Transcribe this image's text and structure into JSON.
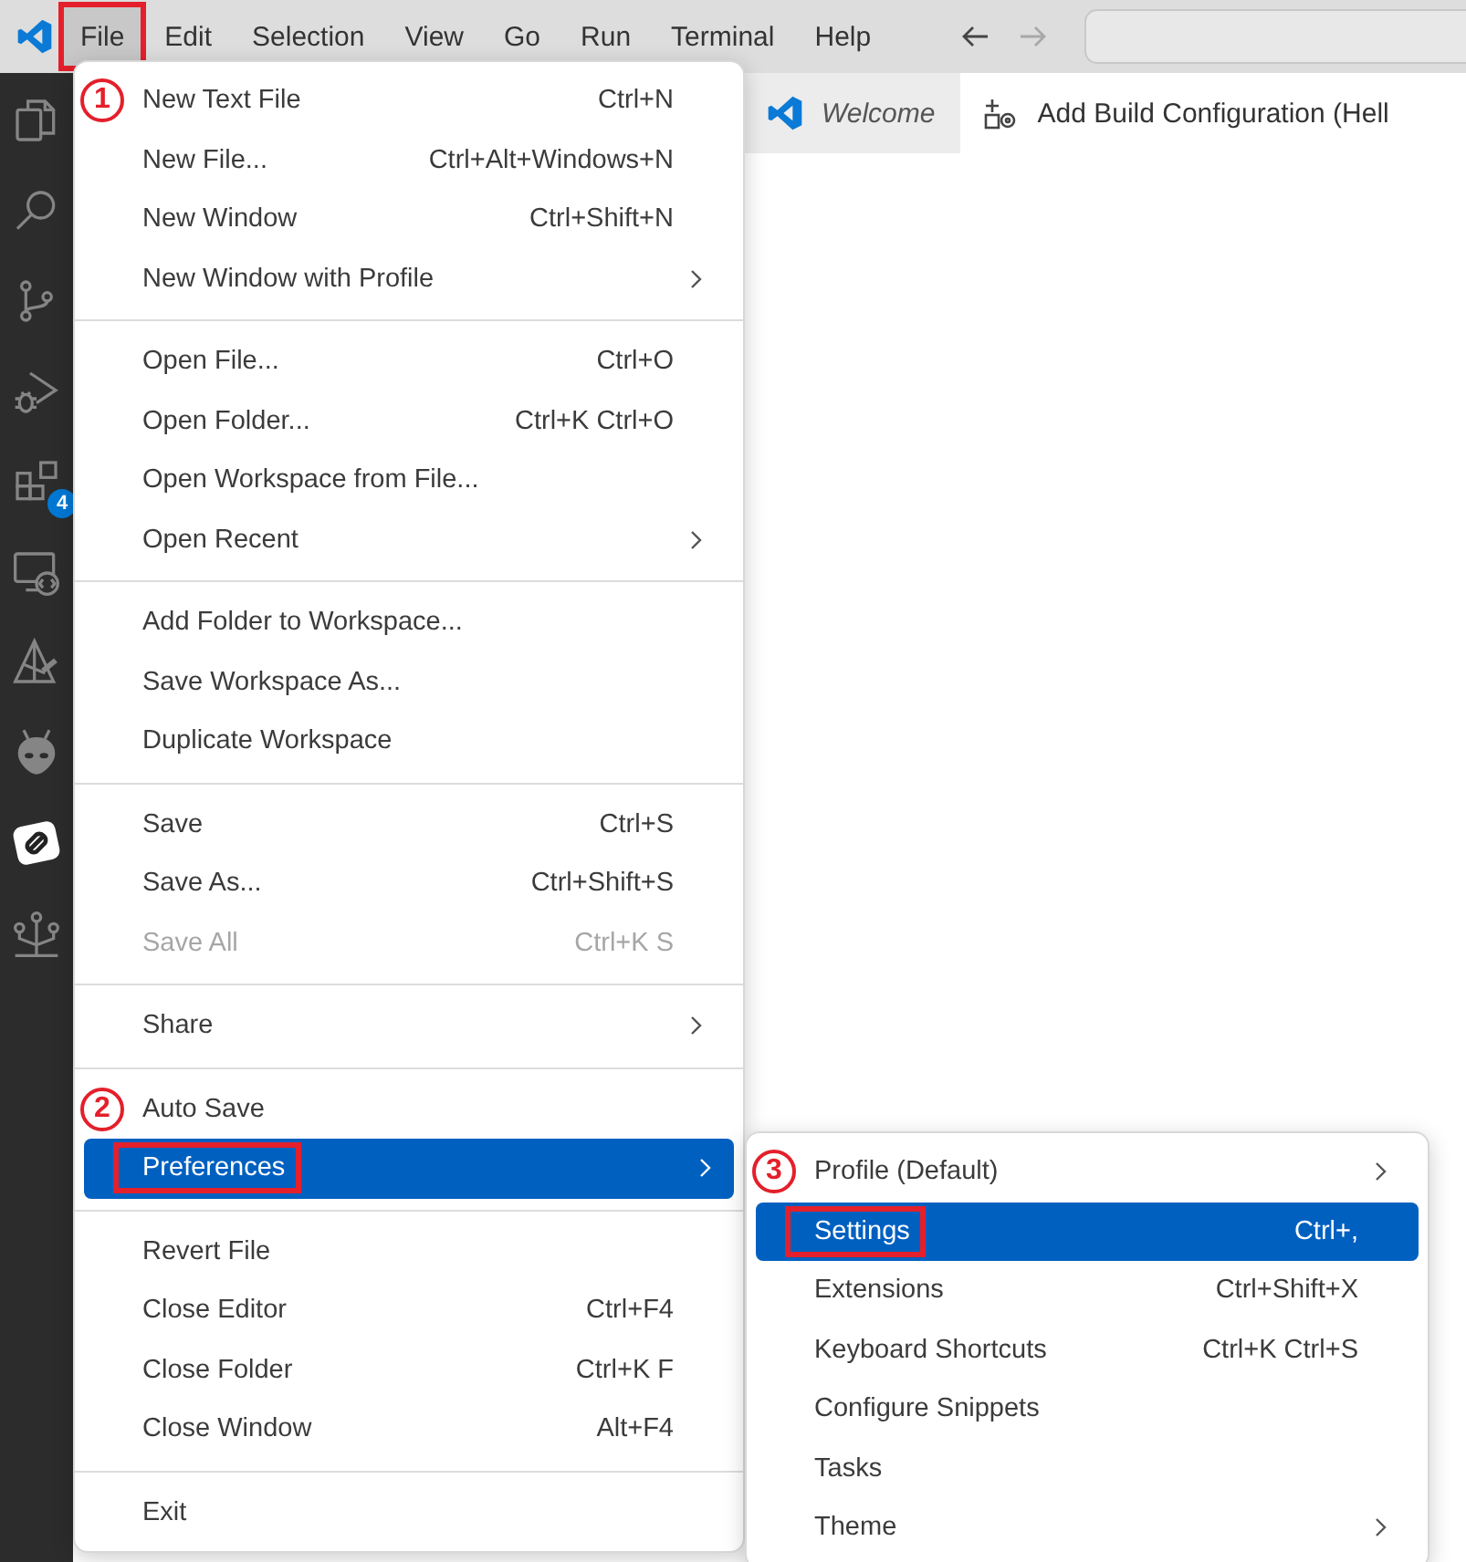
{
  "title_bar": {
    "menus": [
      {
        "label": "File",
        "selected": true,
        "outlined": true
      },
      {
        "label": "Edit",
        "selected": false,
        "outlined": false
      },
      {
        "label": "Selection",
        "selected": false,
        "outlined": false
      },
      {
        "label": "View",
        "selected": false,
        "outlined": false
      },
      {
        "label": "Go",
        "selected": false,
        "outlined": false
      },
      {
        "label": "Run",
        "selected": false,
        "outlined": false
      },
      {
        "label": "Terminal",
        "selected": false,
        "outlined": false
      },
      {
        "label": "Help",
        "selected": false,
        "outlined": false
      }
    ],
    "back_enabled": true,
    "forward_enabled": false
  },
  "activity_bar": {
    "items": [
      {
        "kind": "files",
        "selected": false
      },
      {
        "kind": "search",
        "selected": false
      },
      {
        "kind": "source-control",
        "selected": false
      },
      {
        "kind": "run-debug",
        "selected": false
      },
      {
        "kind": "extensions",
        "selected": false,
        "badge": "4"
      },
      {
        "kind": "remote",
        "selected": false
      },
      {
        "kind": "triangle-wrench",
        "selected": false
      },
      {
        "kind": "alien",
        "selected": false
      },
      {
        "kind": "link",
        "selected": true
      },
      {
        "kind": "tree",
        "selected": false
      }
    ]
  },
  "editor": {
    "tabs": [
      {
        "kind": "welcome",
        "label": "Welcome",
        "selected": false,
        "preview": true
      },
      {
        "kind": "config",
        "label": "Add Build Configuration (Hell",
        "selected": true,
        "preview": false
      }
    ]
  },
  "file_menu": {
    "items": [
      {
        "kind": "item",
        "label": "New Text File",
        "shortcut": "Ctrl+N",
        "submenu": false,
        "disabled": false,
        "selected": false,
        "outlined": false,
        "callout": "1"
      },
      {
        "kind": "item",
        "label": "New File...",
        "shortcut": "Ctrl+Alt+Windows+N",
        "submenu": false,
        "disabled": false,
        "selected": false,
        "outlined": false
      },
      {
        "kind": "item",
        "label": "New Window",
        "shortcut": "Ctrl+Shift+N",
        "submenu": false,
        "disabled": false,
        "selected": false,
        "outlined": false
      },
      {
        "kind": "item",
        "label": "New Window with Profile",
        "submenu": true,
        "disabled": false,
        "selected": false,
        "outlined": false
      },
      {
        "kind": "separator"
      },
      {
        "kind": "item",
        "label": "Open File...",
        "shortcut": "Ctrl+O",
        "submenu": false,
        "disabled": false,
        "selected": false,
        "outlined": false
      },
      {
        "kind": "item",
        "label": "Open Folder...",
        "shortcut": "Ctrl+K Ctrl+O",
        "submenu": false,
        "disabled": false,
        "selected": false,
        "outlined": false
      },
      {
        "kind": "item",
        "label": "Open Workspace from File...",
        "submenu": false,
        "disabled": false,
        "selected": false,
        "outlined": false
      },
      {
        "kind": "item",
        "label": "Open Recent",
        "submenu": true,
        "disabled": false,
        "selected": false,
        "outlined": false
      },
      {
        "kind": "separator"
      },
      {
        "kind": "item",
        "label": "Add Folder to Workspace...",
        "submenu": false,
        "disabled": false,
        "selected": false,
        "outlined": false
      },
      {
        "kind": "item",
        "label": "Save Workspace As...",
        "submenu": false,
        "disabled": false,
        "selected": false,
        "outlined": false
      },
      {
        "kind": "item",
        "label": "Duplicate Workspace",
        "submenu": false,
        "disabled": false,
        "selected": false,
        "outlined": false
      },
      {
        "kind": "separator"
      },
      {
        "kind": "item",
        "label": "Save",
        "shortcut": "Ctrl+S",
        "submenu": false,
        "disabled": false,
        "selected": false,
        "outlined": false
      },
      {
        "kind": "item",
        "label": "Save As...",
        "shortcut": "Ctrl+Shift+S",
        "submenu": false,
        "disabled": false,
        "selected": false,
        "outlined": false
      },
      {
        "kind": "item",
        "label": "Save All",
        "shortcut": "Ctrl+K S",
        "submenu": false,
        "disabled": true,
        "selected": false,
        "outlined": false
      },
      {
        "kind": "separator"
      },
      {
        "kind": "item",
        "label": "Share",
        "submenu": true,
        "disabled": false,
        "selected": false,
        "outlined": false
      },
      {
        "kind": "separator"
      },
      {
        "kind": "item",
        "label": "Auto Save",
        "submenu": false,
        "disabled": false,
        "selected": false,
        "outlined": false,
        "callout": "2"
      },
      {
        "kind": "item",
        "label": "Preferences",
        "submenu": true,
        "disabled": false,
        "selected": true,
        "outlined": true
      },
      {
        "kind": "separator"
      },
      {
        "kind": "item",
        "label": "Revert File",
        "submenu": false,
        "disabled": false,
        "selected": false,
        "outlined": false
      },
      {
        "kind": "item",
        "label": "Close Editor",
        "shortcut": "Ctrl+F4",
        "submenu": false,
        "disabled": false,
        "selected": false,
        "outlined": false
      },
      {
        "kind": "item",
        "label": "Close Folder",
        "shortcut": "Ctrl+K F",
        "submenu": false,
        "disabled": false,
        "selected": false,
        "outlined": false
      },
      {
        "kind": "item",
        "label": "Close Window",
        "shortcut": "Alt+F4",
        "submenu": false,
        "disabled": false,
        "selected": false,
        "outlined": false
      },
      {
        "kind": "separator"
      },
      {
        "kind": "item",
        "label": "Exit",
        "submenu": false,
        "disabled": false,
        "selected": false,
        "outlined": false
      }
    ]
  },
  "preferences_submenu": {
    "items": [
      {
        "kind": "item",
        "label": "Profile (Default)",
        "submenu": true,
        "disabled": false,
        "selected": false,
        "outlined": false,
        "callout": "3"
      },
      {
        "kind": "item",
        "label": "Settings",
        "shortcut": "Ctrl+,",
        "submenu": false,
        "disabled": false,
        "selected": true,
        "outlined": true
      },
      {
        "kind": "item",
        "label": "Extensions",
        "shortcut": "Ctrl+Shift+X",
        "submenu": false,
        "disabled": false,
        "selected": false,
        "outlined": false
      },
      {
        "kind": "item",
        "label": "Keyboard Shortcuts",
        "shortcut": "Ctrl+K Ctrl+S",
        "submenu": false,
        "disabled": false,
        "selected": false,
        "outlined": false
      },
      {
        "kind": "item",
        "label": "Configure Snippets",
        "submenu": false,
        "disabled": false,
        "selected": false,
        "outlined": false
      },
      {
        "kind": "item",
        "label": "Tasks",
        "submenu": false,
        "disabled": false,
        "selected": false,
        "outlined": false
      },
      {
        "kind": "item",
        "label": "Theme",
        "submenu": true,
        "disabled": false,
        "selected": false,
        "outlined": false
      }
    ]
  }
}
